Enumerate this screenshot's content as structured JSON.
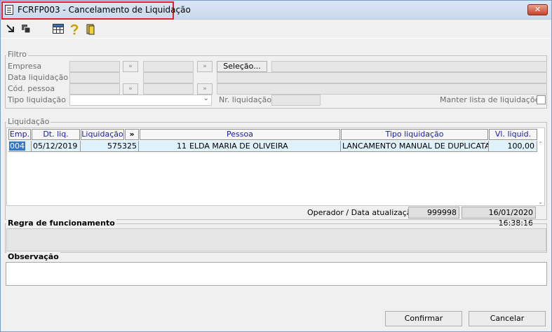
{
  "window": {
    "title": "FCRFP003 - Cancelamento de Liquidação",
    "close_label": "✕"
  },
  "toolbar": {
    "icons": [
      "exit-icon",
      "copy-icon",
      "grid-icon",
      "help-icon",
      "door-icon"
    ]
  },
  "filtro": {
    "group_label": "Filtro",
    "empresa_label": "Empresa",
    "data_liquidacao_label": "Data liquidação",
    "cod_pessoa_label": "Cód. pessoa",
    "tipo_liquidacao_label": "Tipo liquidação",
    "nr_liquidacao_label": "Nr. liquidação",
    "manter_lista_label": "Manter lista de liquidações",
    "selecao_button": "Seleção...",
    "manter_lista_checked": false,
    "tipo_liquidacao_value": "",
    "nr_liquidacao_value": ""
  },
  "liquidacao": {
    "group_label": "Liquidação",
    "columns": {
      "emp": "Emp.",
      "dt_liq": "Dt. liq.",
      "liquidacao": "Liquidação",
      "more": "»",
      "pessoa": "Pessoa",
      "tipo_liquidacao": "Tipo liquidação",
      "vl_liquid": "Vl. liquid."
    },
    "rows": [
      {
        "emp": "004",
        "dt_liq": "05/12/2019",
        "liquidacao": "575325",
        "cod_pessoa": "11",
        "pessoa": "ELDA MARIA DE OLIVEIRA",
        "tipo_liquidacao": "LANCAMENTO MANUAL DE DUPLICATA",
        "vl_liquid": "100,00"
      }
    ],
    "operador_label": "Operador / Data atualização",
    "operador_value": "999998",
    "data_atualizacao_value": "16/01/2020 16:38:16"
  },
  "regra": {
    "label": "Regra de funcionamento",
    "value": ""
  },
  "observacao": {
    "label": "Observação",
    "value": ""
  },
  "actions": {
    "confirmar": "Confirmar",
    "cancelar": "Cancelar"
  }
}
